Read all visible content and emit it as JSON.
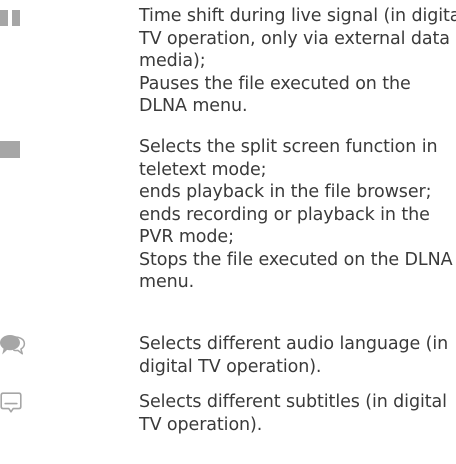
{
  "entries": [
    {
      "icon": "pause-icon",
      "lines": [
        "Time shift during live signal (in digital",
        "TV operation, only via external data",
        "media);",
        "Pauses the file executed on the",
        "DLNA menu."
      ]
    },
    {
      "icon": "stop-icon",
      "lines": [
        "Selects the split screen function in",
        "teletext mode;",
        "ends playback in the file browser;",
        "ends recording or playback in the",
        "PVR mode;",
        "Stops the file executed on the DLNA",
        "menu."
      ]
    },
    {
      "icon": "audio-language-icon",
      "lines": [
        "Selects different audio language (in",
        "digital TV operation)."
      ]
    },
    {
      "icon": "subtitles-icon",
      "lines": [
        "Selects different subtitles (in digital",
        "TV operation)."
      ]
    }
  ],
  "colors": {
    "icon": "#a6a6a6",
    "text": "#3a3a3a"
  }
}
